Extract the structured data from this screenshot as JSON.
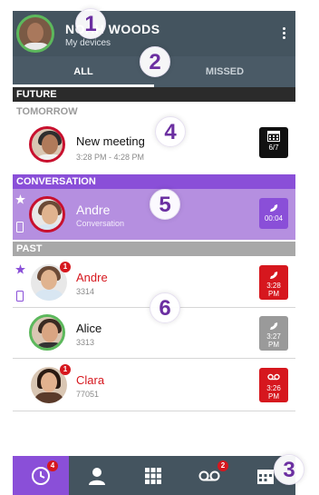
{
  "header": {
    "user_name": "NOAH WOODS",
    "user_sub": "My devices"
  },
  "tabs": [
    {
      "label": "ALL",
      "active": true
    },
    {
      "label": "MISSED",
      "active": false
    }
  ],
  "sections": {
    "future": "FUTURE",
    "tomorrow": "TOMORROW",
    "conversation": "CONVERSATION",
    "past": "PAST"
  },
  "meeting": {
    "title": "New meeting",
    "time": "3:28 PM - 4:28 PM",
    "date": "6/7"
  },
  "conversation": {
    "name": "Andre",
    "sub": "Conversation",
    "duration": "00:04"
  },
  "past": [
    {
      "name": "Andre",
      "number": "3314",
      "time_1": "3:28",
      "time_2": "PM",
      "badge": "1",
      "missed": true
    },
    {
      "name": "Alice",
      "number": "3313",
      "time_1": "3:27",
      "time_2": "PM",
      "badge": "",
      "missed": false
    },
    {
      "name": "Clara",
      "number": "77051",
      "time_1": "3:26",
      "time_2": "PM",
      "badge": "1",
      "missed": true
    }
  ],
  "bottom_nav": {
    "history_badge": "4",
    "voicemail_badge": "2"
  },
  "callouts": [
    "1",
    "2",
    "3",
    "4",
    "5",
    "6"
  ],
  "colors": {
    "header": "#44545f",
    "accent": "#8a4fd8",
    "missed": "#d6171e",
    "online": "#5cb85c"
  }
}
